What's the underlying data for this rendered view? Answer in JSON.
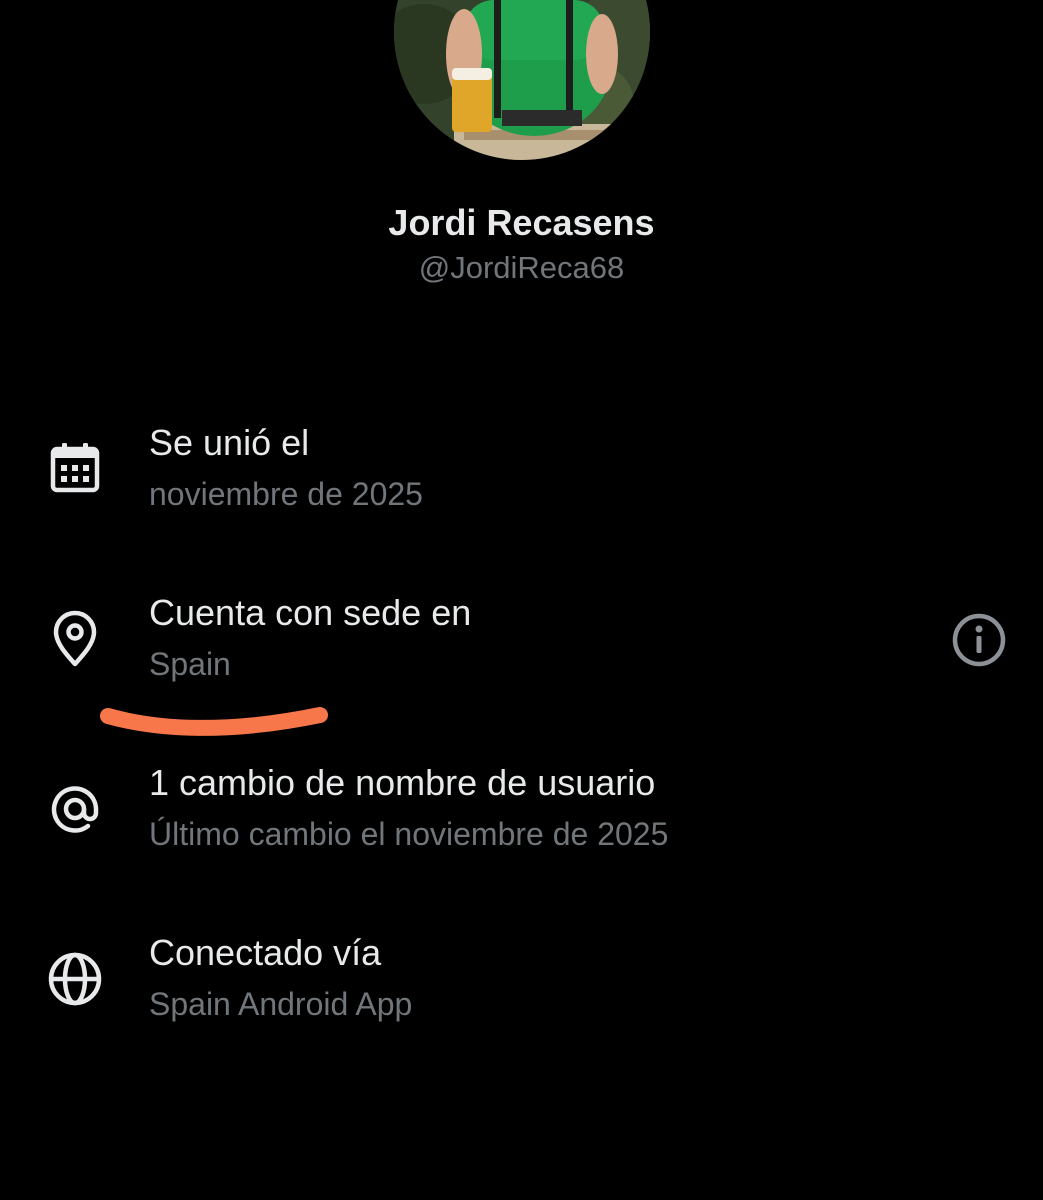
{
  "profile": {
    "name": "Jordi Recasens",
    "handle": "@JordiReca68"
  },
  "about": {
    "joined": {
      "icon": "calendar-icon",
      "title": "Se unió el",
      "value": "noviembre de 2025"
    },
    "location": {
      "icon": "location-pin-icon",
      "title": "Cuenta con sede en",
      "value": "Spain",
      "action_icon": "info-icon"
    },
    "username_changes": {
      "icon": "at-sign-icon",
      "title": "1 cambio de nombre de usuario",
      "value": "Último cambio el noviembre de 2025"
    },
    "connected_via": {
      "icon": "globe-icon",
      "title": "Conectado vía",
      "value": "Spain Android App"
    }
  },
  "colors": {
    "background": "#000000",
    "primary_text": "#e7e9ea",
    "secondary_text": "#71767b",
    "annotation_stroke": "#f7774a"
  }
}
